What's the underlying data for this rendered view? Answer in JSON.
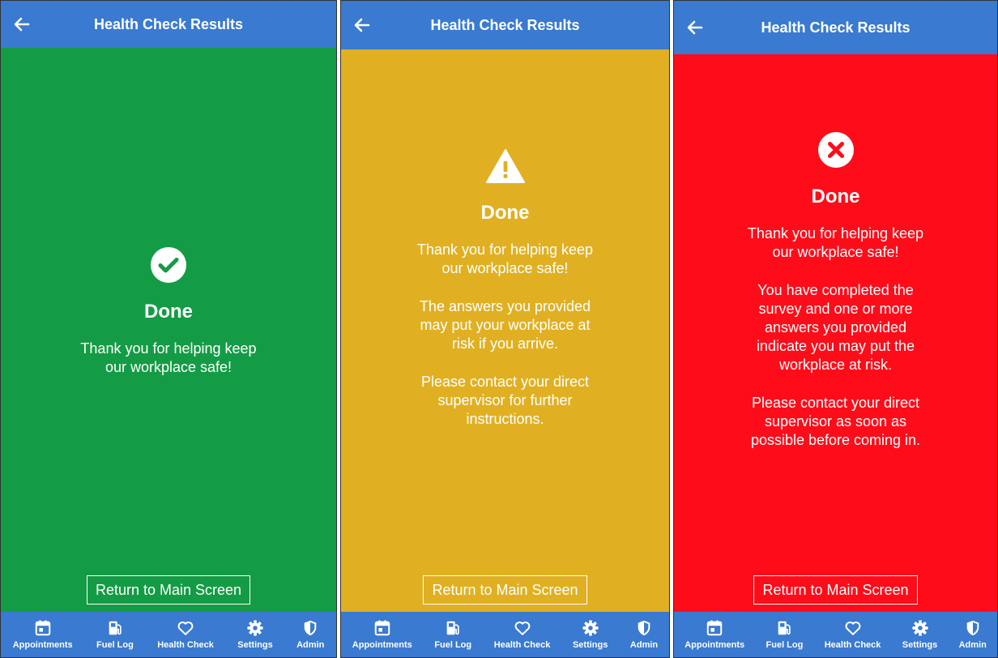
{
  "header": {
    "title": "Health Check Results"
  },
  "done_label": "Done",
  "return_button_label": "Return to Main Screen",
  "tabs": [
    {
      "label": "Appointments",
      "icon": "calendar-icon"
    },
    {
      "label": "Fuel Log",
      "icon": "fuel-pump-icon"
    },
    {
      "label": "Health Check",
      "icon": "heart-icon"
    },
    {
      "label": "Settings",
      "icon": "gear-icon"
    },
    {
      "label": "Admin",
      "icon": "shield-icon"
    }
  ],
  "colors": {
    "header": "#3a7ad0",
    "green": "#149b45",
    "yellow": "#e0b022",
    "red": "#ff0c1a"
  },
  "screens": [
    {
      "status": "safe",
      "icon": "check-circle-icon",
      "messages": [
        "Thank you for helping keep\nour workplace safe!"
      ]
    },
    {
      "status": "warning",
      "icon": "warning-triangle-icon",
      "messages": [
        "Thank you for helping keep\nour workplace safe!",
        "The answers you provided\nmay put your workplace at\nrisk if you arrive.",
        "Please contact your direct\nsupervisor for further\ninstructions."
      ]
    },
    {
      "status": "danger",
      "icon": "x-circle-icon",
      "messages": [
        "Thank you for helping keep\nour workplace safe!",
        "You have completed the\nsurvey and one or more\nanswers you provided\nindicate you may put the\nworkplace at risk.",
        "Please contact your direct\nsupervisor as soon as\npossible before coming in."
      ]
    }
  ]
}
